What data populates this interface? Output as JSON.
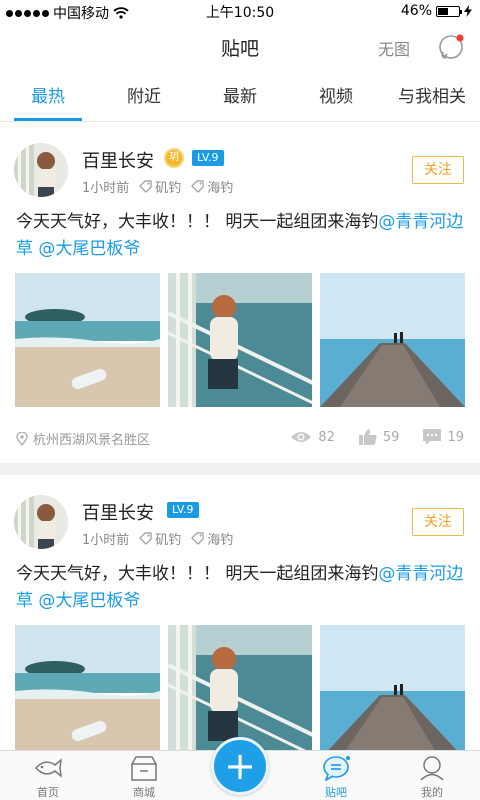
{
  "status_bar": {
    "carrier": "中国移动",
    "time": "上午10:50",
    "battery": "46%",
    "battery_level": 0.46
  },
  "nav": {
    "title": "贴吧",
    "mode_label": "无图"
  },
  "tabs": [
    {
      "label": "最热",
      "active": true
    },
    {
      "label": "附近",
      "active": false
    },
    {
      "label": "最新",
      "active": false
    },
    {
      "label": "视频",
      "active": false
    },
    {
      "label": "与我相关",
      "active": false
    }
  ],
  "posts": [
    {
      "user": "百里长安",
      "coin_badge": "玥",
      "level": "LV.9",
      "time": "1小时前",
      "tags": [
        "矶钓",
        "海钓"
      ],
      "follow_label": "关注",
      "text_prefix": "今天天气好，大丰收！！！ 明天一起组团来海钓",
      "mention_1": "@青青河边草",
      "mention_2": "@大尾巴板爷",
      "location": "杭州西湖风景名胜区",
      "views": "82",
      "likes": "59",
      "comments": "19"
    },
    {
      "user": "百里长安",
      "level": "LV.9",
      "time": "1小时前",
      "tags": [
        "矶钓",
        "海钓"
      ],
      "follow_label": "关注",
      "text_prefix": "今天天气好，大丰收！！！ 明天一起组团来海钓",
      "mention_1": "@青青",
      "mention_1b": "河边草",
      "mention_2": "@大尾巴板爷"
    }
  ],
  "tabbar": {
    "items": [
      {
        "label": "首页",
        "icon": "fish-icon",
        "active": false
      },
      {
        "label": "商城",
        "icon": "store-icon",
        "active": false
      },
      {
        "label": "贴吧",
        "icon": "chat-bubble-icon",
        "active": true
      },
      {
        "label": "我的",
        "icon": "person-icon",
        "active": false
      }
    ],
    "fab_icon": "plus-icon"
  },
  "colors": {
    "accent": "#1a9be6",
    "follow": "#f0a020",
    "level_badge": "#1a9be6",
    "coin": "#f4b62f"
  }
}
